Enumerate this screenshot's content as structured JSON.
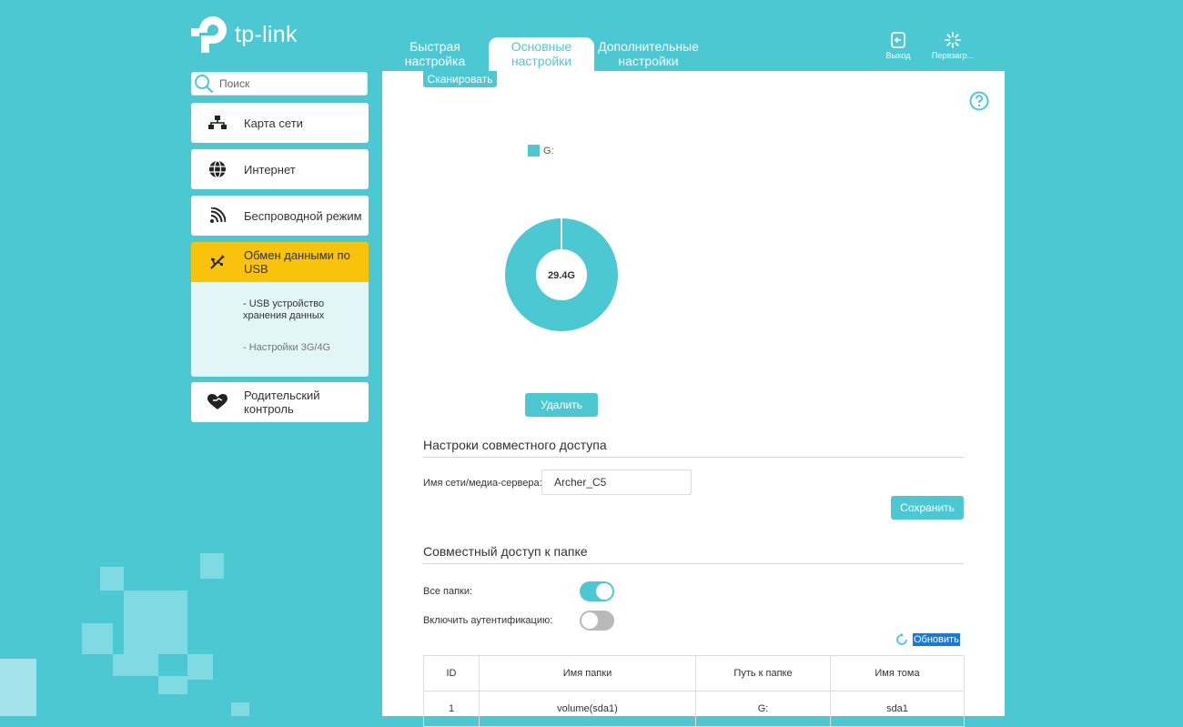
{
  "brand": {
    "name": "tp-link"
  },
  "top_tabs": [
    {
      "label": "Быстрая\nнастройка"
    },
    {
      "label": "Основные\nнастройки"
    },
    {
      "label": "Дополнительные\nнастройки"
    }
  ],
  "top_actions": {
    "logout": "Выход",
    "reboot": "Перезагр..."
  },
  "search": {
    "placeholder": "Поиск"
  },
  "sidebar": {
    "items": [
      {
        "label": "Карта сети",
        "icon": "network-map-icon"
      },
      {
        "label": "Интернет",
        "icon": "globe-icon"
      },
      {
        "label": "Беспроводной режим",
        "icon": "wireless-icon"
      },
      {
        "label": "Обмен данными по USB",
        "icon": "usb-icon"
      },
      {
        "label": "Родительский контроль",
        "icon": "parental-control-icon"
      }
    ],
    "sub_items": [
      {
        "label": "- USB устройство хранения данных"
      },
      {
        "label": "- Настройки 3G/4G"
      }
    ]
  },
  "main": {
    "scan_button": "Сканировать",
    "delete_button": "Удалить",
    "sharing": {
      "title": "Настроки совместного доступа",
      "server_name_label": "Имя сети/медиа-сервера:",
      "server_name_value": "Archer_C5",
      "save_button": "Сохранить"
    },
    "folder_sharing": {
      "title": "Совместный доступ к папке",
      "all_folders_label": "Все папки:",
      "all_folders_on": true,
      "auth_label": "Включить аутентификацию:",
      "auth_on": false,
      "refresh_label": "Обновить"
    },
    "table": {
      "headers": [
        "ID",
        "Имя папки",
        "Путь к папке",
        "Имя тома"
      ],
      "rows": [
        [
          "1",
          "volume(sda1)",
          "G:",
          "sda1"
        ]
      ]
    }
  },
  "chart_data": {
    "type": "pie",
    "legend": [
      "G:"
    ],
    "values": [
      29.4
    ],
    "center_label": "29.4G",
    "colors": [
      "#4cc8d3"
    ]
  },
  "colors": {
    "accent": "#4cc8d3",
    "active_nav": "#f9c30c",
    "submenu_bg": "#e2f6f8"
  }
}
